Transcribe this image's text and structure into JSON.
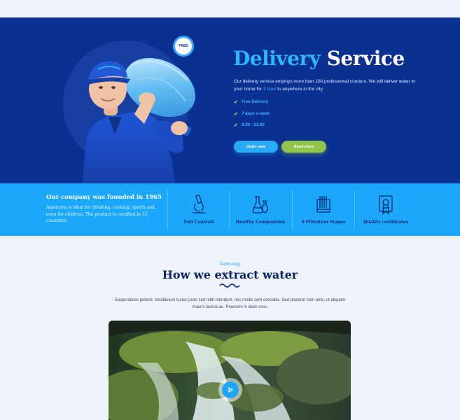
{
  "hero": {
    "badge": "FREE",
    "title_part1": "Delivery",
    "title_part2": "Service",
    "description_before": "Our delivery service employs more than 100 professional couriers. We will deliver water to your home for ",
    "description_highlight": "1 hour",
    "description_after": " to anywhere in the city.",
    "features": [
      "Free Delivery",
      "7 days a week",
      "8:00 - 22:00"
    ],
    "order_button": "Order now",
    "read_button": "Read more",
    "accent_color": "#2eb6ff",
    "background_color": "#0a3192"
  },
  "band": {
    "title": "Our company was founded in 1965",
    "text": "Aquatiras is ideal for drinking, cooking, sports and even for children. The product is certified in 12 countries.",
    "features": [
      {
        "label": "Full Controll",
        "icon": "microscope-icon"
      },
      {
        "label": "Healthy Composition",
        "icon": "flask-icon"
      },
      {
        "label": "6 Filtration Stages",
        "icon": "filter-icon"
      },
      {
        "label": "Quality certificates",
        "icon": "certificate-icon"
      }
    ],
    "background_color": "#1ba7fb"
  },
  "technology": {
    "kicker": "Technology",
    "title": "How we extract water",
    "description": "Suspendisse potenti. Vestibulum luctus justo sed nibh interdum, nec mollis sem convallis. Sed placerat sem ante, ut aliquam mauris lacinia ac. Praesent in diam eros.",
    "play_icon": "play-icon"
  }
}
